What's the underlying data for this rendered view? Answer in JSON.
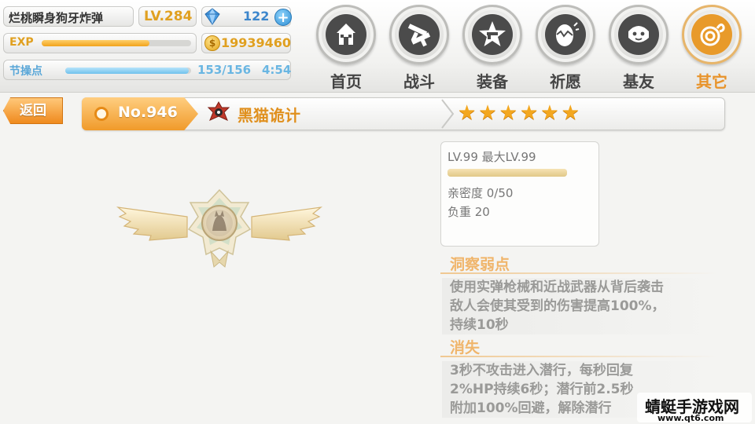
{
  "player": {
    "name": "烂桃瞬身狗牙炸弹",
    "level": "LV.284",
    "gems": "122",
    "gold": "19939460",
    "exp_label": "EXP",
    "exp_progress": 0.72,
    "stamina_label": "节操点",
    "stamina_value": "153/156",
    "stamina_progress": 0.98,
    "stamina_timer": "4:54"
  },
  "nav": [
    {
      "label": "首页",
      "icon": "house-icon",
      "active": false
    },
    {
      "label": "战斗",
      "icon": "crossed-guns-icon",
      "active": false
    },
    {
      "label": "装备",
      "icon": "star-gun-icon",
      "active": false
    },
    {
      "label": "祈愿",
      "icon": "egg-icon",
      "active": false
    },
    {
      "label": "基友",
      "icon": "friend-face-icon",
      "active": false
    },
    {
      "label": "其它",
      "icon": "other-swirl-icon",
      "active": true
    }
  ],
  "header": {
    "back_label": "返回",
    "card_number": "No.946",
    "card_name": "黑猫诡计",
    "star_count": 6
  },
  "stats": {
    "level_text": "LV.99 最大LV.99",
    "level_progress": 1.0,
    "affinity": "亲密度 0/50",
    "weight": "负重 20"
  },
  "skills": [
    {
      "title": "洞察弱点",
      "lines": [
        "使用实弹枪械和近战武器从背后袭击",
        "敌人会使其受到的伤害提高100%，",
        "持续10秒"
      ]
    },
    {
      "title": "消失",
      "lines": [
        "3秒不攻击进入潜行，每秒回复",
        "2%HP持续6秒；潜行前2.5秒",
        "附加100%回避，解除潜行"
      ]
    }
  ],
  "watermark": {
    "main": "蜻蜓手游戏网",
    "sub": "www.qt6.com"
  },
  "colors": {
    "accent_orange": "#f09a2a",
    "gold_text": "#e0a020",
    "blue_text": "#6ab6e2",
    "skill_title": "#f0b56b"
  }
}
